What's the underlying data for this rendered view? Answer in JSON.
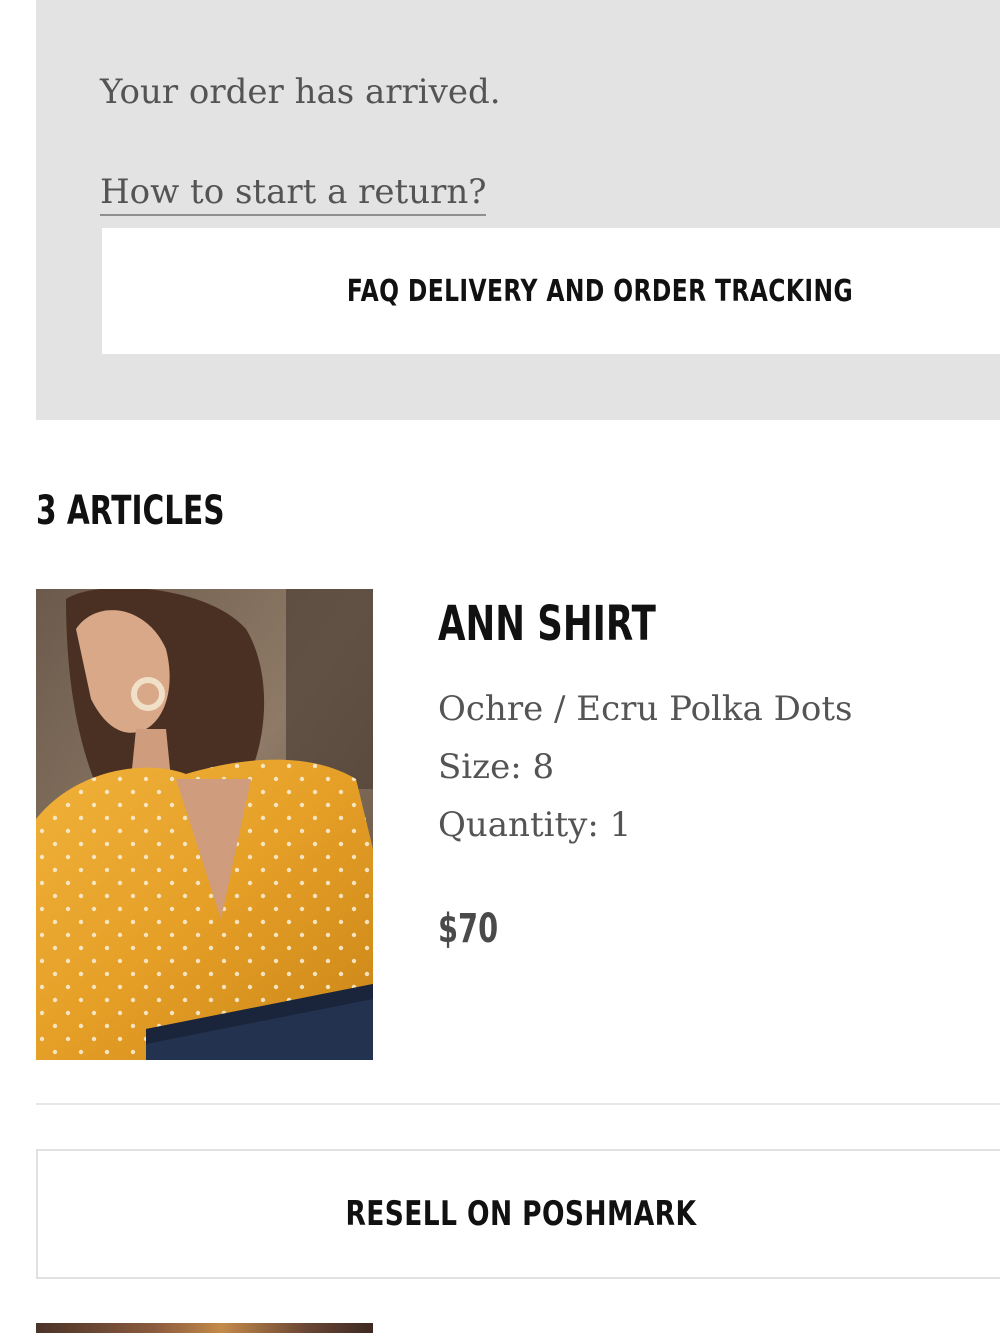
{
  "order_status": {
    "message": "Your order has arrived.",
    "return_link": "How to start a return?",
    "faq_button": "FAQ DELIVERY AND ORDER TRACKING"
  },
  "articles": {
    "count_label": "3 ARTICLES",
    "items": [
      {
        "image": "product-photo-yellow-polka-dot-shirt",
        "name": "ANN SHIRT",
        "color": "Ochre / Ecru Polka Dots",
        "size": "Size: 8",
        "quantity": "Quantity: 1",
        "price": "$70"
      }
    ]
  },
  "resell_button": "RESELL ON POSHMARK",
  "colors": {
    "panel_background": "#e3e3e3",
    "text_dark": "#111111",
    "text_muted": "#545454",
    "shirt_ochre": "#e0a22e"
  }
}
